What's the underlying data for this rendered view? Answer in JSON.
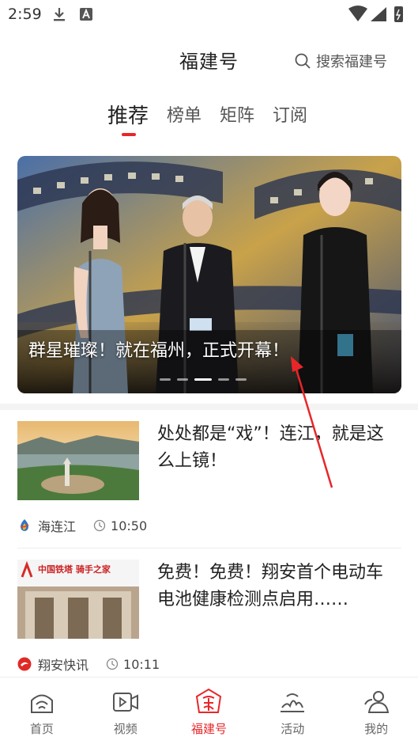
{
  "status_bar": {
    "time": "2:59"
  },
  "header": {
    "title": "福建号",
    "search_placeholder": "搜索福建号"
  },
  "tabs": [
    {
      "label": "推荐",
      "active": true
    },
    {
      "label": "榜单",
      "active": false
    },
    {
      "label": "矩阵",
      "active": false
    },
    {
      "label": "订阅",
      "active": false
    }
  ],
  "banner": {
    "caption": "群星璀璨！就在福州，正式开幕！",
    "slide_count": 5,
    "active_slide": 3
  },
  "news": [
    {
      "title": "处处都是“戏”！连江，就是这么上镜！",
      "source": "海连江",
      "time": "10:50",
      "source_icon": "flame-logo-icon"
    },
    {
      "title": "免费！免费！翔安首个电动车电池健康检测点启用……",
      "source": "翔安快讯",
      "time": "10:11",
      "source_icon": "red-circle-logo-icon",
      "thumb_text": "中国铁塔 骑手之家"
    }
  ],
  "bottom_nav": [
    {
      "label": "首页",
      "icon": "home-icon",
      "active": false
    },
    {
      "label": "视频",
      "icon": "video-icon",
      "active": false
    },
    {
      "label": "福建号",
      "icon": "fu-logo-icon",
      "active": true
    },
    {
      "label": "活动",
      "icon": "activity-icon",
      "active": false
    },
    {
      "label": "我的",
      "icon": "profile-icon",
      "active": false
    }
  ],
  "colors": {
    "accent": "#e8262a",
    "text": "#222222",
    "muted": "#666666"
  }
}
